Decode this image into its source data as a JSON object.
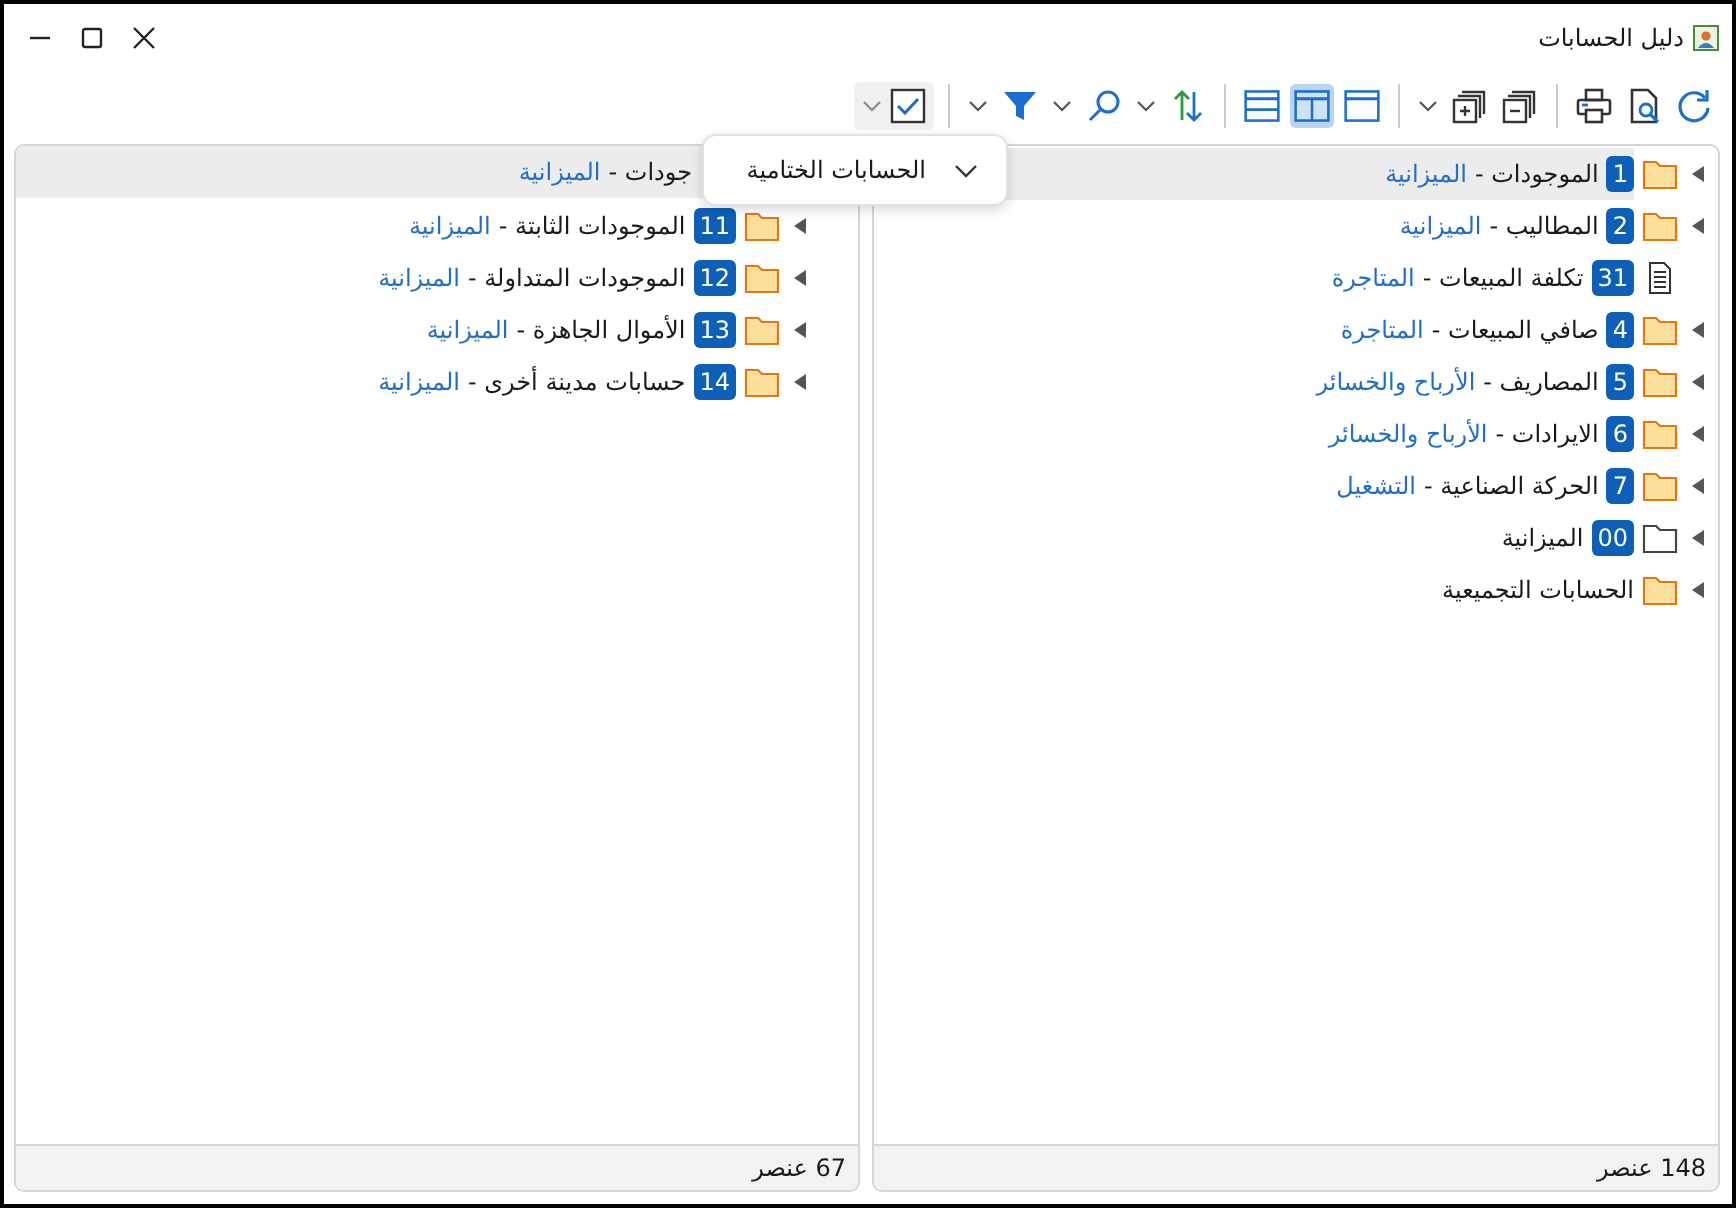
{
  "window": {
    "title": "دليل الحسابات"
  },
  "toolbar": {
    "checkbox_checked": true,
    "layouts": [
      {
        "selected": false
      },
      {
        "selected": true
      },
      {
        "selected": false
      }
    ]
  },
  "right_pane": {
    "items": [
      {
        "kind": "folder",
        "code": "1",
        "name": "الموجودات -",
        "category": "الميزانية",
        "selected": true,
        "expandable": true
      },
      {
        "kind": "folder",
        "code": "2",
        "name": "المطاليب -",
        "category": "الميزانية",
        "selected": false,
        "expandable": true
      },
      {
        "kind": "document",
        "code": "31",
        "name": "تكلفة المبيعات -",
        "category": "المتاجرة",
        "selected": false,
        "expandable": false
      },
      {
        "kind": "folder",
        "code": "4",
        "name": "صافي المبيعات -",
        "category": "المتاجرة",
        "selected": false,
        "expandable": true
      },
      {
        "kind": "folder",
        "code": "5",
        "name": "المصاريف -",
        "category": "الأرباح والخسائر",
        "selected": false,
        "expandable": true
      },
      {
        "kind": "folder",
        "code": "6",
        "name": "الايرادات -",
        "category": "الأرباح والخسائر",
        "selected": false,
        "expandable": true
      },
      {
        "kind": "folder",
        "code": "7",
        "name": "الحركة الصناعية -",
        "category": "التشغيل",
        "selected": false,
        "expandable": true
      },
      {
        "kind": "empty-folder",
        "code": "00",
        "name": "الميزانية",
        "selected": false,
        "expandable": true
      },
      {
        "kind": "folder",
        "name": "الحسابات التجميعية",
        "selected": false,
        "expandable": true
      }
    ],
    "footer": "148 عنصر"
  },
  "left_pane": {
    "header": {
      "name": "جودات -",
      "category": "الميزانية"
    },
    "items": [
      {
        "kind": "folder",
        "code": "11",
        "name": "الموجودات الثابتة -",
        "category": "الميزانية",
        "selected": false,
        "expandable": true
      },
      {
        "kind": "folder",
        "code": "12",
        "name": "الموجودات المتداولة -",
        "category": "الميزانية",
        "selected": false,
        "expandable": true
      },
      {
        "kind": "folder",
        "code": "13",
        "name": "الأموال الجاهزة -",
        "category": "الميزانية",
        "selected": false,
        "expandable": true
      },
      {
        "kind": "folder",
        "code": "14",
        "name": "حسابات مدينة أخرى -",
        "category": "الميزانية",
        "selected": false,
        "expandable": true
      }
    ],
    "footer": "67 عنصر"
  },
  "popup": {
    "label": "الحسابات الختامية"
  }
}
